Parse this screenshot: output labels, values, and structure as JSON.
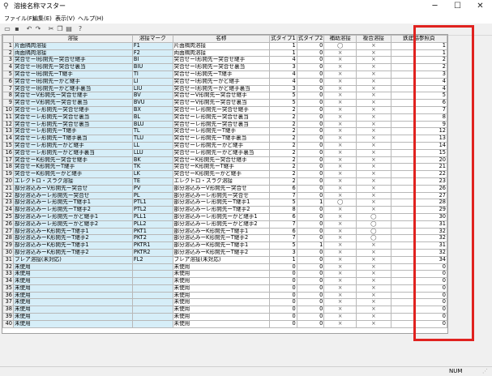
{
  "window": {
    "title": "溶接名称マスター",
    "minimize": "─",
    "maximize": "☐",
    "close": "✕"
  },
  "menu": [
    "ファイル(F)",
    "編集(E)",
    "表示(V)",
    "ヘルプ(H)"
  ],
  "toolbar_icons": [
    "open-icon",
    "save-icon",
    "undo-icon",
    "redo-icon",
    "cut-icon",
    "copy-icon",
    "paste-icon",
    "help-icon"
  ],
  "columns": [
    "",
    "溶接",
    "溶接マーク",
    "名称",
    "式タイプ1",
    "式タイプ2",
    "補助溶接",
    "複合溶接",
    "鉄建協参照頁"
  ],
  "rows": [
    [
      "1",
      "片面隅肉溶接",
      "F1",
      "片面隅肉溶接",
      "1",
      "0",
      "◯",
      "×",
      "1"
    ],
    [
      "2",
      "両面隅肉溶接",
      "F2",
      "両面隅肉溶接",
      "1",
      "0",
      "×",
      "×",
      "1"
    ],
    [
      "3",
      "突合せーI形開先ー突合せ継手",
      "BI",
      "突合せーI形開先ー突合せ継手",
      "4",
      "0",
      "×",
      "×",
      "2"
    ],
    [
      "4",
      "突合せーI形開先ー突合せ裏当",
      "BIU",
      "突合せーI形開先ー突合せ裏当",
      "3",
      "0",
      "×",
      "×",
      "2"
    ],
    [
      "5",
      "突合せーI形開先ーT継手",
      "TI",
      "突合せーI形開先ーT継手",
      "4",
      "0",
      "×",
      "×",
      "3"
    ],
    [
      "6",
      "突合せーI形開先ーかど継手",
      "LI",
      "突合せーI形開先ーかど継手",
      "4",
      "0",
      "×",
      "×",
      "4"
    ],
    [
      "7",
      "突合せーI形開先ーかど継手裏当",
      "LIU",
      "突合せーI形開先ーかど継手裏当",
      "3",
      "0",
      "×",
      "×",
      "4"
    ],
    [
      "8",
      "突合せーV形開先ー突合せ継手",
      "BV",
      "突合せーV形開先ー突合せ継手",
      "5",
      "0",
      "×",
      "×",
      "5"
    ],
    [
      "9",
      "突合せーV形開先ー突合せ裏当",
      "BVU",
      "突合せーV形開先ー突合せ裏当",
      "5",
      "0",
      "×",
      "×",
      "6"
    ],
    [
      "10",
      "突合せーレ形開先ー突合せ継手",
      "BX",
      "突合せーレ形開先ー突合せ継手",
      "2",
      "0",
      "×",
      "×",
      "7"
    ],
    [
      "11",
      "突合せーレ形開先ー突合せ裏当",
      "BL",
      "突合せーレ形開先ー突合せ裏当",
      "2",
      "0",
      "×",
      "×",
      "8"
    ],
    [
      "12",
      "突合せーレ形開先ー突合せ裏当",
      "BLU",
      "突合せーレ形開先ー突合せ裏当",
      "2",
      "0",
      "×",
      "×",
      "9"
    ],
    [
      "13",
      "突合せーレ形開先ーT継手",
      "TL",
      "突合せーレ形開先ーT継手",
      "2",
      "0",
      "×",
      "×",
      "12"
    ],
    [
      "14",
      "突合せーレ形開先ーT継手裏当",
      "TLU",
      "突合せーレ形開先ーT継手裏当",
      "2",
      "0",
      "×",
      "×",
      "13"
    ],
    [
      "15",
      "突合せーレ形開先ーかど継手",
      "LL",
      "突合せーレ形開先ーかど継手",
      "2",
      "0",
      "×",
      "×",
      "14"
    ],
    [
      "16",
      "突合せーレ形開先ーかど継手裏当",
      "LLU",
      "突合せーレ形開先ーかど継手裏当",
      "2",
      "0",
      "×",
      "×",
      "15"
    ],
    [
      "17",
      "突合せーK形開先ー突合せ継手",
      "BK",
      "突合せーK形開先ー突合せ継手",
      "2",
      "0",
      "×",
      "×",
      "20"
    ],
    [
      "18",
      "突合せーK形開先ーT継手",
      "TK",
      "突合せーK形開先ーT継手",
      "2",
      "0",
      "×",
      "×",
      "21"
    ],
    [
      "19",
      "突合せーK形開先ーかど継手",
      "LK",
      "突合せーK形開先ーかど継手",
      "2",
      "0",
      "×",
      "×",
      "22"
    ],
    [
      "20",
      "エレクトロ・スラグ溶接",
      "TE",
      "エレクトロ・スラグ溶接",
      "2",
      "0",
      "×",
      "×",
      "23"
    ],
    [
      "21",
      "部分溶込みーV形開先ー突合せ",
      "PV",
      "部分溶込みーV形開先ー突合せ",
      "6",
      "0",
      "×",
      "×",
      "26"
    ],
    [
      "22",
      "部分溶込みーレ形開先ー突合せ",
      "PL",
      "部分溶込みーレ形開先ー突合せ",
      "7",
      "0",
      "×",
      "×",
      "27"
    ],
    [
      "23",
      "部分溶込みーレ形開先ーT継手1",
      "PTL1",
      "部分溶込みーレ形開先ーT継手1",
      "5",
      "1",
      "◯",
      "×",
      "28"
    ],
    [
      "24",
      "部分溶込みーレ形開先ーT継手2",
      "PTL2",
      "部分溶込みーレ形開先ーT継手2",
      "8",
      "0",
      "×",
      "×",
      "29"
    ],
    [
      "25",
      "部分溶込みーレ形開先ーかど継手1",
      "PLL1",
      "部分溶込みーレ形開先ーかど継手1",
      "6",
      "0",
      "×",
      "◯",
      "30"
    ],
    [
      "26",
      "部分溶込みーレ形開先ーかど継手2",
      "PLL2",
      "部分溶込みーレ形開先ーかど継手2",
      "7",
      "0",
      "×",
      "◯",
      "31"
    ],
    [
      "27",
      "部分溶込みーK形開先ーT継手1",
      "PKT1",
      "部分溶込みーK形開先ーT継手1",
      "6",
      "0",
      "×",
      "◯",
      "32"
    ],
    [
      "28",
      "部分溶込みーK形開先ーT継手2",
      "PKT2",
      "部分溶込みーK形開先ーT継手2",
      "7",
      "0",
      "×",
      "◯",
      "32"
    ],
    [
      "29",
      "部分溶込みーK形開先ーT継手1",
      "PKTR1",
      "部分溶込みーK形開先ーT継手1",
      "5",
      "1",
      "×",
      "×",
      "31"
    ],
    [
      "30",
      "部分溶込みーK形開先ーT継手2",
      "PKTR2",
      "部分溶込みーK形開先ーT継手2",
      "3",
      "0",
      "×",
      "×",
      "32"
    ],
    [
      "31",
      "フレア溶接(未対応)",
      "FL2",
      "フレア溶接(未対応)",
      "1",
      "0",
      "×",
      "×",
      "34"
    ],
    [
      "32",
      "未使用",
      "",
      "未使用",
      "0",
      "0",
      "×",
      "×",
      "0"
    ],
    [
      "33",
      "未使用",
      "",
      "未使用",
      "0",
      "0",
      "×",
      "×",
      "0"
    ],
    [
      "34",
      "未使用",
      "",
      "未使用",
      "0",
      "0",
      "×",
      "×",
      "0"
    ],
    [
      "35",
      "未使用",
      "",
      "未使用",
      "0",
      "0",
      "×",
      "×",
      "0"
    ],
    [
      "36",
      "未使用",
      "",
      "未使用",
      "0",
      "0",
      "×",
      "×",
      "0"
    ],
    [
      "37",
      "未使用",
      "",
      "未使用",
      "0",
      "0",
      "×",
      "×",
      "0"
    ],
    [
      "38",
      "未使用",
      "",
      "未使用",
      "0",
      "0",
      "×",
      "×",
      "0"
    ],
    [
      "39",
      "未使用",
      "",
      "未使用",
      "0",
      "0",
      "×",
      "×",
      "0"
    ],
    [
      "40",
      "未使用",
      "",
      "未使用",
      "0",
      "0",
      "×",
      "×",
      "0"
    ]
  ],
  "status": {
    "num": "NUM",
    "grip": "⋰"
  },
  "highlight_color": "#e0221f",
  "cell_highlight_color": "#d6eef8"
}
